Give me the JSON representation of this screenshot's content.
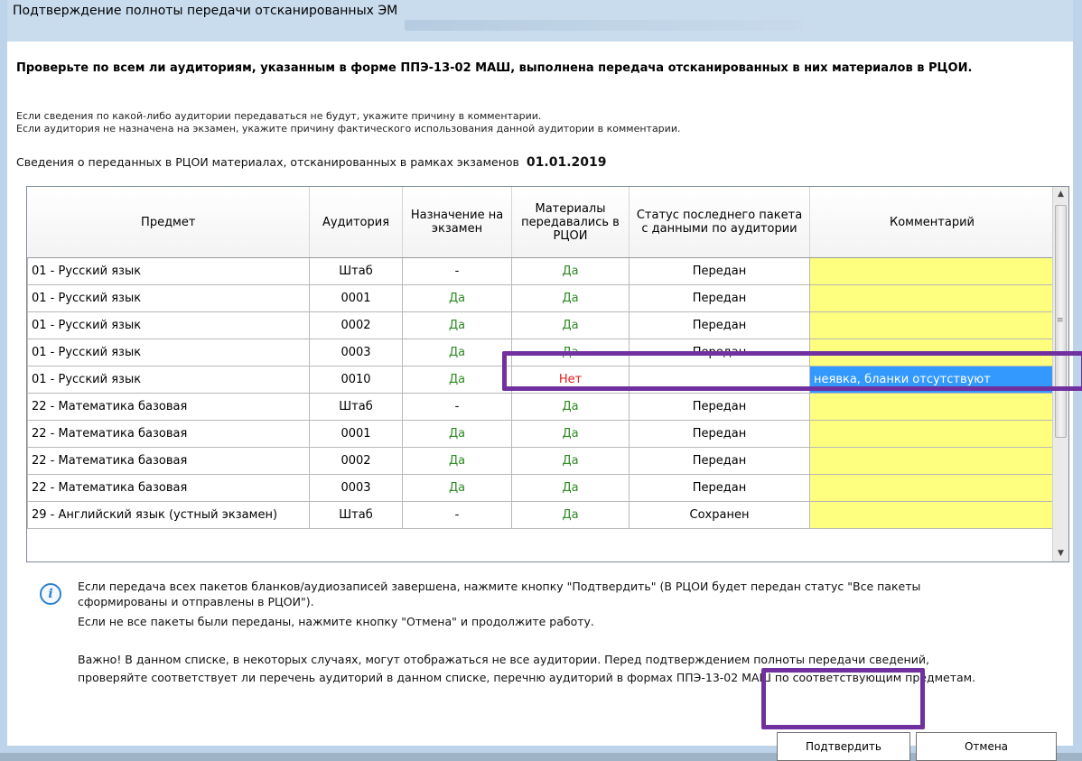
{
  "window": {
    "title": "Подтверждение полноты передачи отсканированных ЭМ"
  },
  "heading": "Проверьте по всем ли аудиториям, указанным в форме ППЭ-13-02 МАШ, выполнена передача отсканированных в них материалов в РЦОИ.",
  "notes": [
    "Если сведения по какой-либо аудитории передаваться не будут, укажите причину в комментарии.",
    "Если аудитория не назначена на экзамен, укажите причину фактического использования данной аудитории в комментарии."
  ],
  "summary": {
    "label": "Сведения о переданных в РЦОИ материалах, отсканированных в рамках экзаменов",
    "date": "01.01.2019"
  },
  "table": {
    "headers": [
      "Предмет",
      "Аудитория",
      "Назначение на экзамен",
      "Материалы передавались в РЦОИ",
      "Статус последнего пакета с данными по аудитории",
      "Комментарий"
    ],
    "rows": [
      {
        "subject": "01 - Русский язык",
        "room": "Штаб",
        "assigned": "-",
        "sent": "Да",
        "status": "Передан",
        "comment": ""
      },
      {
        "subject": "01 - Русский язык",
        "room": "0001",
        "assigned": "Да",
        "sent": "Да",
        "status": "Передан",
        "comment": ""
      },
      {
        "subject": "01 - Русский язык",
        "room": "0002",
        "assigned": "Да",
        "sent": "Да",
        "status": "Передан",
        "comment": ""
      },
      {
        "subject": "01 - Русский язык",
        "room": "0003",
        "assigned": "Да",
        "sent": "Да",
        "status": "Передан",
        "comment": ""
      },
      {
        "subject": "01 - Русский язык",
        "room": "0010",
        "assigned": "Да",
        "sent": "Нет",
        "status": "",
        "comment": "неявка, бланки отсутствуют"
      },
      {
        "subject": "22 - Математика базовая",
        "room": "Штаб",
        "assigned": "-",
        "sent": "Да",
        "status": "Передан",
        "comment": ""
      },
      {
        "subject": "22 - Математика базовая",
        "room": "0001",
        "assigned": "Да",
        "sent": "Да",
        "status": "Передан",
        "comment": ""
      },
      {
        "subject": "22 - Математика базовая",
        "room": "0002",
        "assigned": "Да",
        "sent": "Да",
        "status": "Передан",
        "comment": ""
      },
      {
        "subject": "22 - Математика базовая",
        "room": "0003",
        "assigned": "Да",
        "sent": "Да",
        "status": "Передан",
        "comment": ""
      },
      {
        "subject": "29 - Английский язык (устный экзамен)",
        "room": "Штаб",
        "assigned": "-",
        "sent": "Да",
        "status": "Сохранен",
        "comment": ""
      }
    ]
  },
  "info": {
    "line1": "Если передача всех пакетов бланков/аудиозаписей завершена, нажмите кнопку \"Подтвердить\" (В РЦОИ будет передан статус \"Все пакеты",
    "line2": "сформированы и отправлены в РЦОИ\").",
    "line3": "Если не все пакеты были переданы, нажмите кнопку \"Отмена\" и продолжите работу.",
    "warning1": "Важно! В данном списке, в некоторых случаях, могут отображаться не все аудитории. Перед подтверждением полноты передачи сведений,",
    "warning2": "проверяйте соответствует ли перечень аудиторий в данном списке, перечню аудиторий в формах ППЭ-13-02 МАШ по соответствующим предметам."
  },
  "buttons": {
    "confirm": "Подтвердить",
    "cancel": "Отмена"
  },
  "colors": {
    "yes": "#2e8a23",
    "no": "#e51b1b",
    "comment_bg": "#ffff7f",
    "selected_bg": "#3399ff",
    "highlight": "#7030a0"
  }
}
